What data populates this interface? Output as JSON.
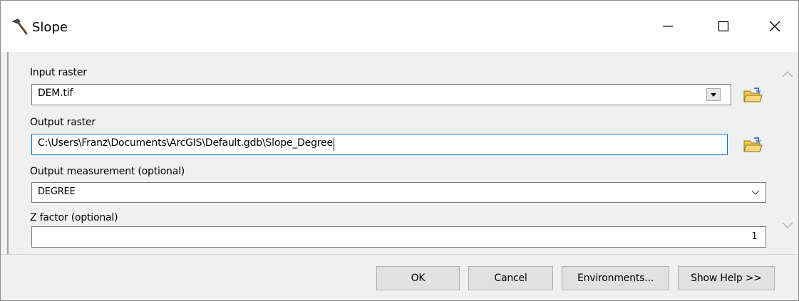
{
  "window": {
    "title": "Slope"
  },
  "titlebar_buttons": {
    "minimize": "minimize-icon",
    "maximize": "maximize-icon",
    "close": "close-icon"
  },
  "form": {
    "input_raster": {
      "label": "Input raster",
      "value": "DEM.tif"
    },
    "output_raster": {
      "label": "Output raster",
      "value": "C:\\Users\\Franz\\Documents\\ArcGIS\\Default.gdb\\Slope_Degree"
    },
    "output_measurement": {
      "label": "Output measurement (optional)",
      "value": "DEGREE"
    },
    "z_factor": {
      "label": "Z factor (optional)",
      "value": "1"
    }
  },
  "buttons": {
    "ok": "OK",
    "cancel": "Cancel",
    "environments": "Environments...",
    "show_help": "Show Help >>"
  },
  "colors": {
    "folder_icon": "#f2c94c",
    "focus_border": "#0078d7"
  }
}
